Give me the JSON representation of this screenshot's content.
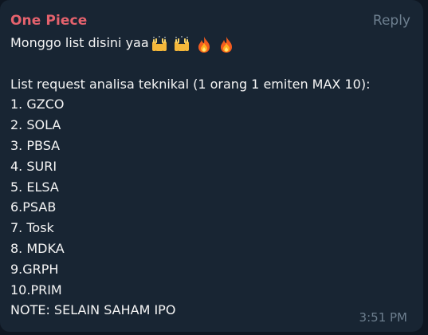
{
  "message": {
    "sender": "One Piece",
    "reply_label": "Reply",
    "greeting": "Monggo list disini yaa",
    "emoji_icons": [
      "raising-hands-icon",
      "raising-hands-icon",
      "fire-icon",
      "fire-icon"
    ],
    "list_title": "List request analisa teknikal  (1 orang 1 emiten MAX 10):",
    "items": [
      "1. GZCO",
      "2. SOLA",
      "3. PBSA",
      "4. SURI",
      "5. ELSA",
      "6.PSAB",
      "7. Tosk",
      "8. MDKA",
      "9.GRPH",
      "10.PRIM"
    ],
    "note": "NOTE: SELAIN SAHAM IPO",
    "time": "3:51 PM"
  },
  "colors": {
    "background": "#0e1621",
    "bubble": "#182533",
    "sender": "#e5626d",
    "text": "#f5f5f5",
    "muted": "#6d7f8f"
  }
}
